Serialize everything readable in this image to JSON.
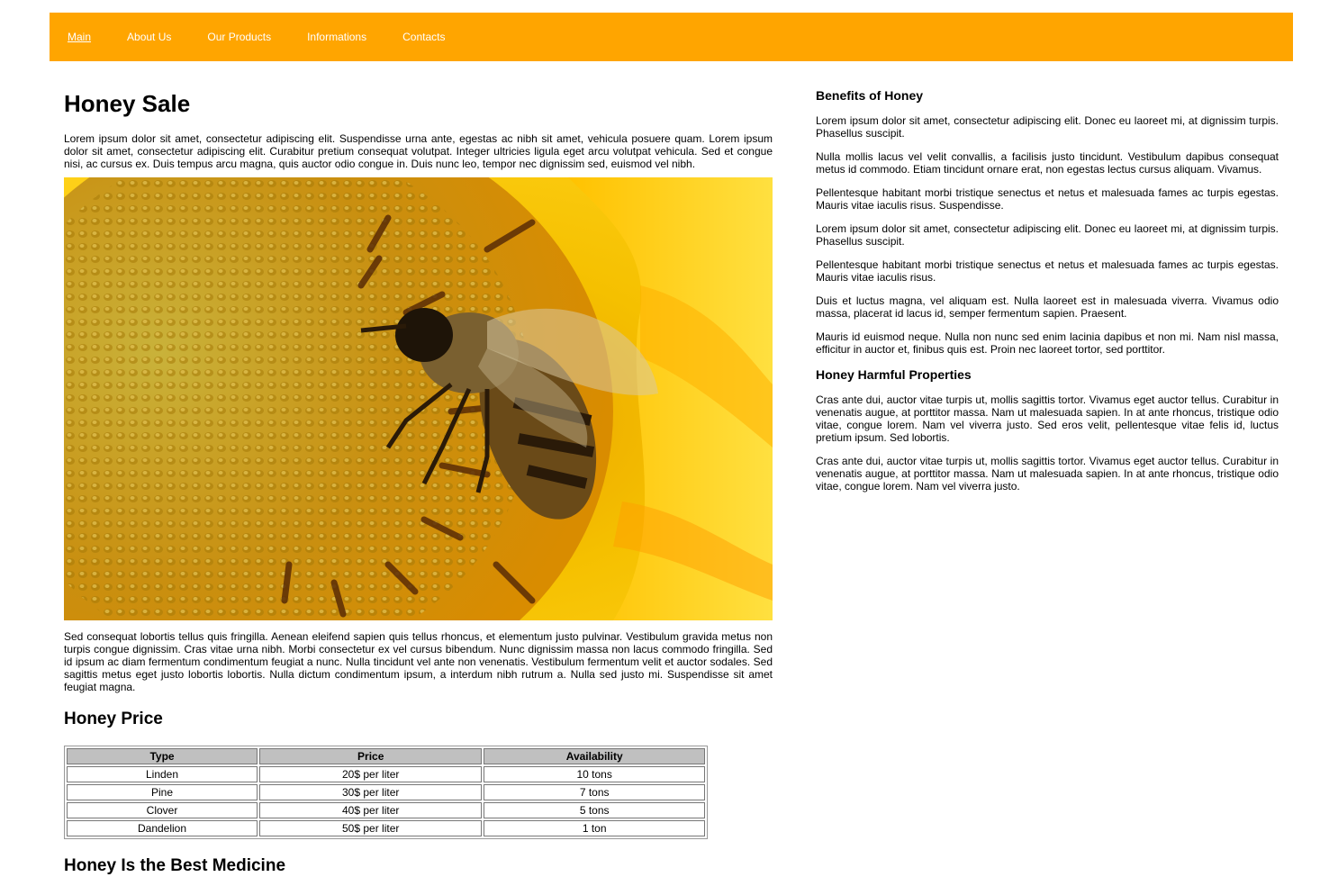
{
  "nav": {
    "items": [
      "Main",
      "About Us",
      "Our Products",
      "Informations",
      "Contacts"
    ]
  },
  "colors": {
    "nav_bg": "#ffa500",
    "nav_text": "#ffffff",
    "table_header_bg": "#c0c0c0"
  },
  "main": {
    "title": "Honey Sale",
    "intro": "Lorem ipsum dolor sit amet, consectetur adipiscing elit. Suspendisse urna ante, egestas ac nibh sit amet, vehicula posuere quam. Lorem ipsum dolor sit amet, consectetur adipiscing elit. Curabitur pretium consequat volutpat. Integer ultricies ligula eget arcu volutpat vehicula. Sed et congue nisi, ac cursus ex. Duis tempus arcu magna, quis auctor odio congue in. Duis nunc leo, tempor nec dignissim sed, euismod vel nibh.",
    "image_icon": "bee-on-sunflower-image",
    "body": "Sed consequat lobortis tellus quis fringilla. Aenean eleifend sapien quis tellus rhoncus, et elementum justo pulvinar. Vestibulum gravida metus non turpis congue dignissim. Cras vitae urna nibh. Morbi consectetur ex vel cursus bibendum. Nunc dignissim massa non lacus commodo fringilla. Sed id ipsum ac diam fermentum condimentum feugiat a nunc. Nulla tincidunt vel ante non venenatis. Vestibulum fermentum velit et auctor sodales. Sed sagittis metus eget justo lobortis lobortis. Nulla dictum condimentum ipsum, a interdum nibh rutrum a. Nulla sed justo mi. Suspendisse sit amet feugiat magna.",
    "price_title": "Honey Price",
    "table": {
      "headers": [
        "Type",
        "Price",
        "Availability"
      ],
      "rows": [
        [
          "Linden",
          "20$ per liter",
          "10 tons"
        ],
        [
          "Pine",
          "30$ per liter",
          "7 tons"
        ],
        [
          "Clover",
          "40$ per liter",
          "5 tons"
        ],
        [
          "Dandelion",
          "50$ per liter",
          "1 ton"
        ]
      ]
    },
    "medicine_title": "Honey Is the Best Medicine"
  },
  "aside": {
    "benefits_title": "Benefits of Honey",
    "benefits": [
      "Lorem ipsum dolor sit amet, consectetur adipiscing elit. Donec eu laoreet mi, at dignissim turpis. Phasellus suscipit.",
      "Nulla mollis lacus vel velit convallis, a facilisis justo tincidunt. Vestibulum dapibus consequat metus id commodo. Etiam tincidunt ornare erat, non egestas lectus cursus aliquam. Vivamus.",
      "Pellentesque habitant morbi tristique senectus et netus et malesuada fames ac turpis egestas. Mauris vitae iaculis risus. Suspendisse.",
      "Lorem ipsum dolor sit amet, consectetur adipiscing elit. Donec eu laoreet mi, at dignissim turpis. Phasellus suscipit.",
      "Pellentesque habitant morbi tristique senectus et netus et malesuada fames ac turpis egestas. Mauris vitae iaculis risus.",
      "Duis et luctus magna, vel aliquam est. Nulla laoreet est in malesuada viverra. Vivamus odio massa, placerat id lacus id, semper fermentum sapien. Praesent.",
      "Mauris id euismod neque. Nulla non nunc sed enim lacinia dapibus et non mi. Nam nisl massa, efficitur in auctor et, finibus quis est. Proin nec laoreet tortor, sed porttitor."
    ],
    "harmful_title": "Honey Harmful Properties",
    "harmful": [
      "Cras ante dui, auctor vitae turpis ut, mollis sagittis tortor. Vivamus eget auctor tellus. Curabitur in venenatis augue, at porttitor massa. Nam ut malesuada sapien. In at ante rhoncus, tristique odio vitae, congue lorem. Nam vel viverra justo. Sed eros velit, pellentesque vitae felis id, luctus pretium ipsum. Sed lobortis.",
      "Cras ante dui, auctor vitae turpis ut, mollis sagittis tortor. Vivamus eget auctor tellus. Curabitur in venenatis augue, at porttitor massa. Nam ut malesuada sapien. In at ante rhoncus, tristique odio vitae, congue lorem. Nam vel viverra justo."
    ]
  }
}
